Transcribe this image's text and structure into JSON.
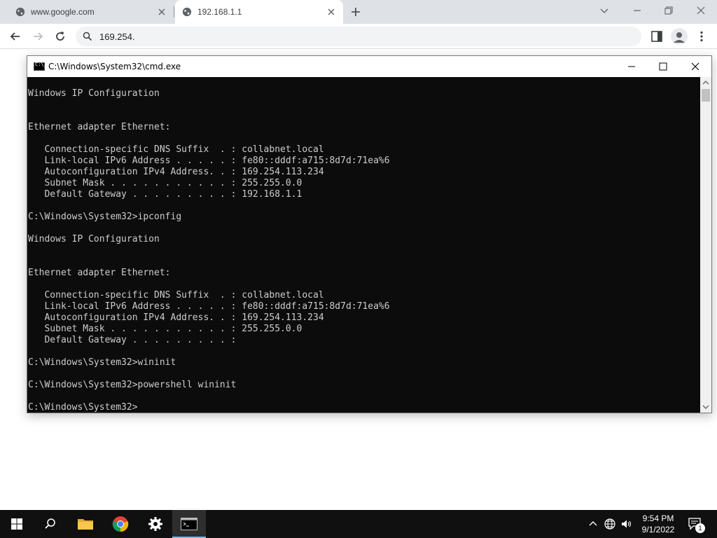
{
  "browser": {
    "tabs": [
      {
        "title": "www.google.com",
        "active": false
      },
      {
        "title": "192.168.1.1",
        "active": true
      }
    ],
    "address_bar": {
      "value": "169.254."
    }
  },
  "cmd": {
    "title": "C:\\Windows\\System32\\cmd.exe",
    "icon_text": "C:\\_",
    "console_lines": [
      "Windows IP Configuration",
      "",
      "",
      "Ethernet adapter Ethernet:",
      "",
      "   Connection-specific DNS Suffix  . : collabnet.local",
      "   Link-local IPv6 Address . . . . . : fe80::dddf:a715:8d7d:71ea%6",
      "   Autoconfiguration IPv4 Address. . : 169.254.113.234",
      "   Subnet Mask . . . . . . . . . . . : 255.255.0.0",
      "   Default Gateway . . . . . . . . . : 192.168.1.1",
      "",
      "C:\\Windows\\System32>ipconfig",
      "",
      "Windows IP Configuration",
      "",
      "",
      "Ethernet adapter Ethernet:",
      "",
      "   Connection-specific DNS Suffix  . : collabnet.local",
      "   Link-local IPv6 Address . . . . . : fe80::dddf:a715:8d7d:71ea%6",
      "   Autoconfiguration IPv4 Address. . : 169.254.113.234",
      "   Subnet Mask . . . . . . . . . . . : 255.255.0.0",
      "   Default Gateway . . . . . . . . . :",
      "",
      "C:\\Windows\\System32>wininit",
      "",
      "C:\\Windows\\System32>powershell wininit",
      "",
      "C:\\Windows\\System32>"
    ]
  },
  "taskbar": {
    "time": "9:54 PM",
    "date": "9/1/2022",
    "notification_count": "1"
  },
  "colors": {
    "console_bg": "#0c0c0c",
    "console_fg": "#cccccc",
    "taskbar_bg": "#101010",
    "tabstrip_bg": "#dee1e6",
    "active_indicator": "#76b9ed"
  }
}
